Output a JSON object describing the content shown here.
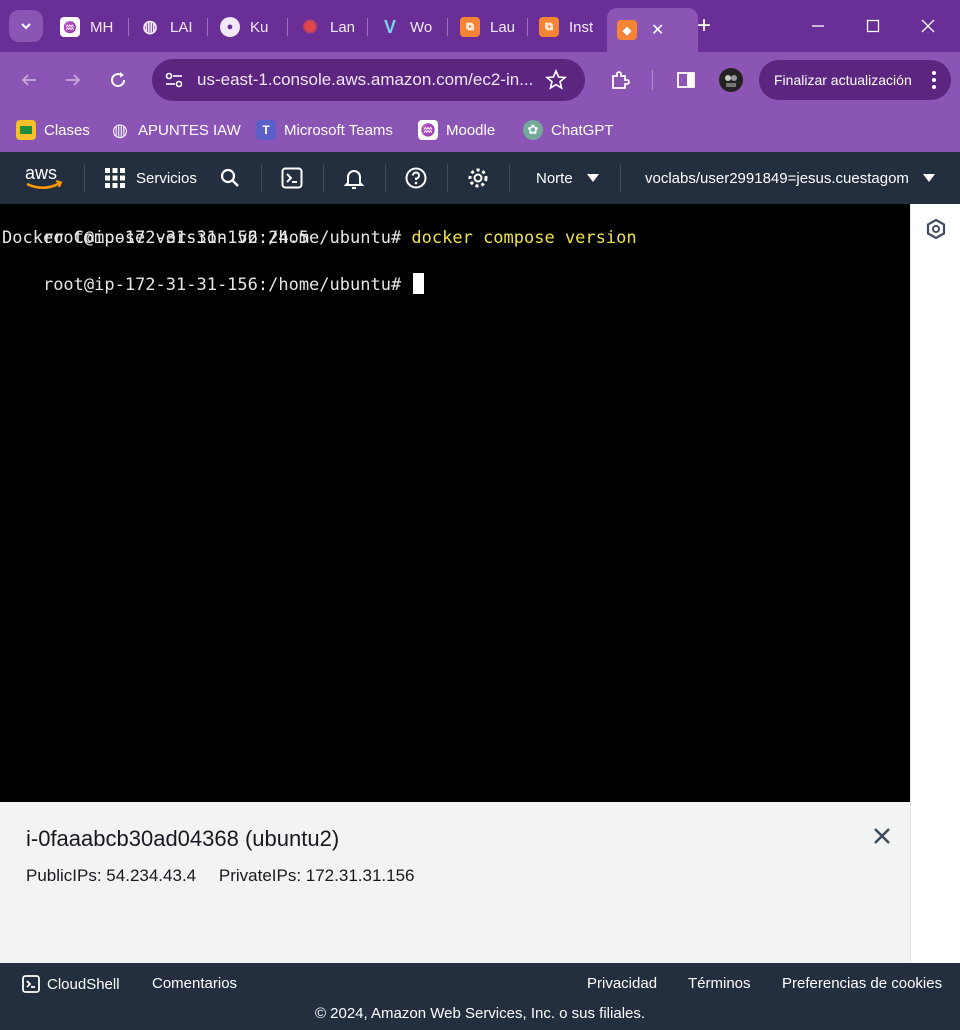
{
  "browser": {
    "tabs": [
      {
        "label": "MH",
        "icon": "moodle-icon"
      },
      {
        "label": "LAI",
        "icon": "globe-icon"
      },
      {
        "label": "Ku",
        "icon": "github-icon"
      },
      {
        "label": "Lan",
        "icon": "canvas-icon"
      },
      {
        "label": "Wo",
        "icon": "vercel-icon"
      },
      {
        "label": "Lau",
        "icon": "aws-instances-icon"
      },
      {
        "label": "Inst",
        "icon": "aws-instances-icon"
      }
    ],
    "active_tab_icon": "aws-cube-icon",
    "url": "us-east-1.console.aws.amazon.com/ec2-in...",
    "update_button": "Finalizar actualización",
    "bookmarks": [
      {
        "label": "Clases",
        "icon": "classroom-icon"
      },
      {
        "label": "APUNTES IAW",
        "icon": "globe-icon"
      },
      {
        "label": "Microsoft Teams",
        "icon": "teams-icon"
      },
      {
        "label": "Moodle",
        "icon": "moodle-icon"
      },
      {
        "label": "ChatGPT",
        "icon": "chatgpt-icon"
      }
    ],
    "colors": {
      "frame": "#6a2f96",
      "toolbar": "#8a55b4",
      "omnibox": "#5b2580"
    }
  },
  "aws": {
    "logo": "aws",
    "services": "Servicios",
    "region": "Norte",
    "account": "voclabs/user2991849=jesus.cuestagom",
    "colors": {
      "header": "#232f3e"
    }
  },
  "terminal": {
    "lines": [
      {
        "prompt": "root@ip-172-31-31-156:/home/ubuntu# ",
        "command": "docker compose version"
      },
      {
        "output": "Docker Compose version v2.24.5"
      },
      {
        "prompt": "root@ip-172-31-31-156:/home/ubuntu# ",
        "command": ""
      }
    ]
  },
  "instance": {
    "title": "i-0faaabcb30ad04368 (ubuntu2)",
    "public_ips": "PublicIPs: 54.234.43.4",
    "private_ips": "PrivateIPs: 172.31.31.156"
  },
  "footer": {
    "cloudshell": "CloudShell",
    "feedback": "Comentarios",
    "privacy": "Privacidad",
    "terms": "Términos",
    "cookies": "Preferencias de cookies",
    "copyright": "© 2024, Amazon Web Services, Inc. o sus filiales."
  }
}
